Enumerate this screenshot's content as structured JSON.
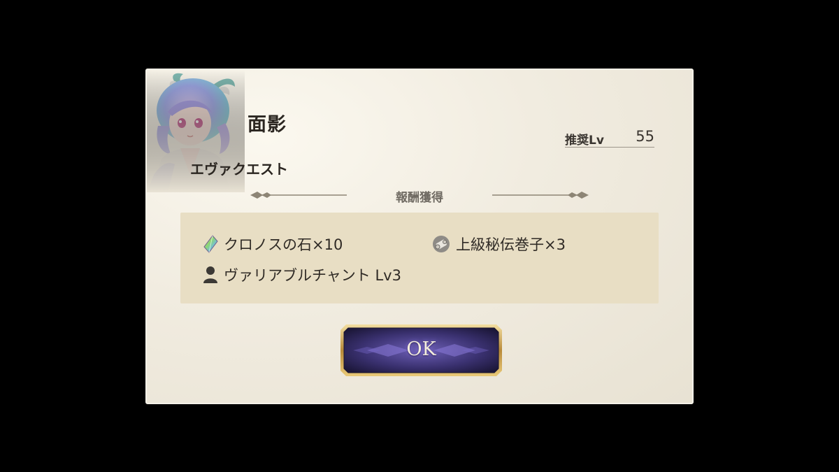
{
  "dialog": {
    "title": "面影",
    "subtitle": "エヴァクエスト",
    "recommended_level": {
      "label": "推奨Lv",
      "value": "55"
    },
    "reward_header": "報酬獲得",
    "rewards": [
      {
        "icon": "crystal-icon",
        "text": "クロノスの石×10"
      },
      {
        "icon": "scroll-icon",
        "text": "上級秘伝巻子×3"
      },
      {
        "icon": "person-icon",
        "text": "ヴァリアブルチャント Lv3"
      }
    ],
    "ok_label": "OK"
  }
}
